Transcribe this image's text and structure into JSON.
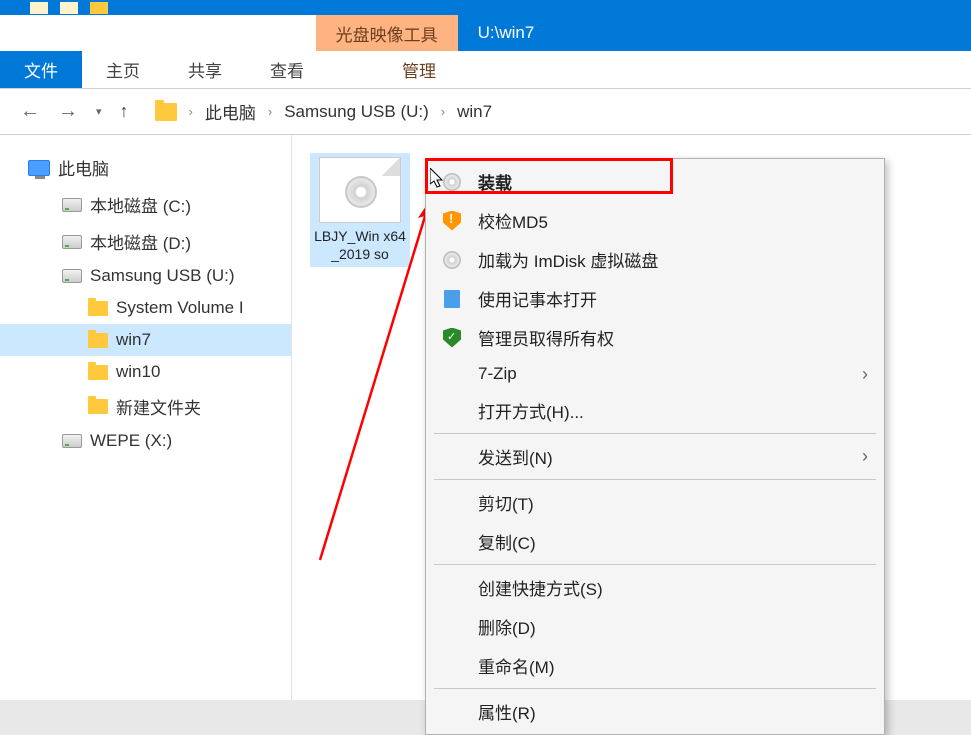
{
  "titlebar": {
    "contextual_tab": "光盘映像工具",
    "title": "U:\\win7"
  },
  "ribbon": {
    "file": "文件",
    "home": "主页",
    "share": "共享",
    "view": "查看",
    "manage": "管理"
  },
  "breadcrumb": {
    "item1": "此电脑",
    "item2": "Samsung USB (U:)",
    "item3": "win7"
  },
  "sidebar": {
    "this_pc": "此电脑",
    "drive_c": "本地磁盘 (C:)",
    "drive_d": "本地磁盘 (D:)",
    "drive_u": "Samsung USB (U:)",
    "svi": "System Volume I",
    "win7": "win7",
    "win10": "win10",
    "new_folder": "新建文件夹",
    "wepe": "WEPE (X:)"
  },
  "file": {
    "name": "LBJY_Win x64_2019 so"
  },
  "menu": {
    "mount": "装载",
    "md5": "校检MD5",
    "imdisk": "加载为 ImDisk 虚拟磁盘",
    "notepad": "使用记事本打开",
    "admin_own": "管理员取得所有权",
    "sevenzip": "7-Zip",
    "open_with": "打开方式(H)...",
    "send_to": "发送到(N)",
    "cut": "剪切(T)",
    "copy": "复制(C)",
    "shortcut": "创建快捷方式(S)",
    "delete": "删除(D)",
    "rename": "重命名(M)",
    "properties": "属性(R)"
  }
}
